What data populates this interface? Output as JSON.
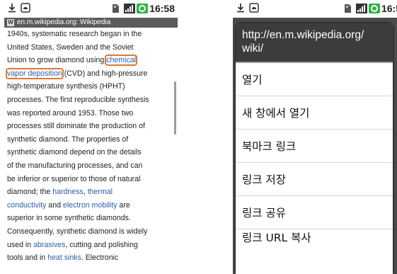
{
  "left_screen": {
    "status": {
      "time": "16:58",
      "icons": [
        "download-icon",
        "android-debug-icon",
        "sd-card-icon",
        "signal-icon",
        "battery-icon"
      ]
    },
    "url_bar": {
      "title": "en.m.wikipedia.org: Wikipedia"
    },
    "article_lines": [
      {
        "parts": [
          {
            "t": "1940s, systematic research began in the"
          }
        ]
      },
      {
        "parts": [
          {
            "t": "United States, Sweden and the Soviet"
          }
        ]
      },
      {
        "parts": [
          {
            "t": "Union to grow diamond using "
          },
          {
            "t": "chemical",
            "link": true,
            "hl": true
          }
        ]
      },
      {
        "parts": [
          {
            "t": "vapor deposition",
            "link": true,
            "hl": true
          },
          {
            "t": " (CVD) and high-pressure"
          }
        ]
      },
      {
        "parts": [
          {
            "t": "high-temperature synthesis (HPHT)"
          }
        ]
      },
      {
        "parts": [
          {
            "t": "processes. The first reproducible synthesis"
          }
        ]
      },
      {
        "parts": [
          {
            "t": "was reported around 1953. Those two"
          }
        ]
      },
      {
        "parts": [
          {
            "t": "processes still dominate the production of"
          }
        ]
      },
      {
        "parts": [
          {
            "t": "synthetic diamond. The properties of"
          }
        ]
      },
      {
        "parts": [
          {
            "t": "synthetic diamond depend on the details"
          }
        ]
      },
      {
        "parts": [
          {
            "t": "of the manufacturing processes, and can"
          }
        ]
      },
      {
        "parts": [
          {
            "t": "be inferior or superior to those of natural"
          }
        ]
      },
      {
        "parts": [
          {
            "t": "diamond; the "
          },
          {
            "t": "hardness",
            "link": true
          },
          {
            "t": ", "
          },
          {
            "t": "thermal",
            "link": true
          }
        ]
      },
      {
        "parts": [
          {
            "t": "conductivity",
            "link": true
          },
          {
            "t": " and "
          },
          {
            "t": "electron mobility",
            "link": true
          },
          {
            "t": " are"
          }
        ]
      },
      {
        "parts": [
          {
            "t": "superior in some synthetic diamonds."
          }
        ]
      },
      {
        "parts": [
          {
            "t": "Consequently, synthetic diamond is widely"
          }
        ]
      },
      {
        "parts": [
          {
            "t": "used in "
          },
          {
            "t": "abrasives",
            "link": true
          },
          {
            "t": ", cutting and polishing"
          }
        ]
      },
      {
        "parts": [
          {
            "t": "tools and in "
          },
          {
            "t": "heat sinks",
            "link": true
          },
          {
            "t": ". Electronic"
          }
        ]
      }
    ]
  },
  "right_screen": {
    "status": {
      "time": "16:5",
      "icons": [
        "download-icon",
        "android-debug-icon",
        "sd-card-icon",
        "signal-icon",
        "battery-icon"
      ]
    },
    "dialog": {
      "title": "http://en.m.wikipedia.org/\nwiki/",
      "items": [
        "열기",
        "새 창에서 열기",
        "북마크 링크",
        "링크 저장",
        "링크 공유",
        "링크 URL 복사"
      ]
    }
  },
  "colors": {
    "link": "#2a5db0",
    "highlight": "#e0782e",
    "url_bar": "#5b5b5b",
    "dialog_title": "#3c3c3c",
    "battery": "#2fb34a"
  }
}
